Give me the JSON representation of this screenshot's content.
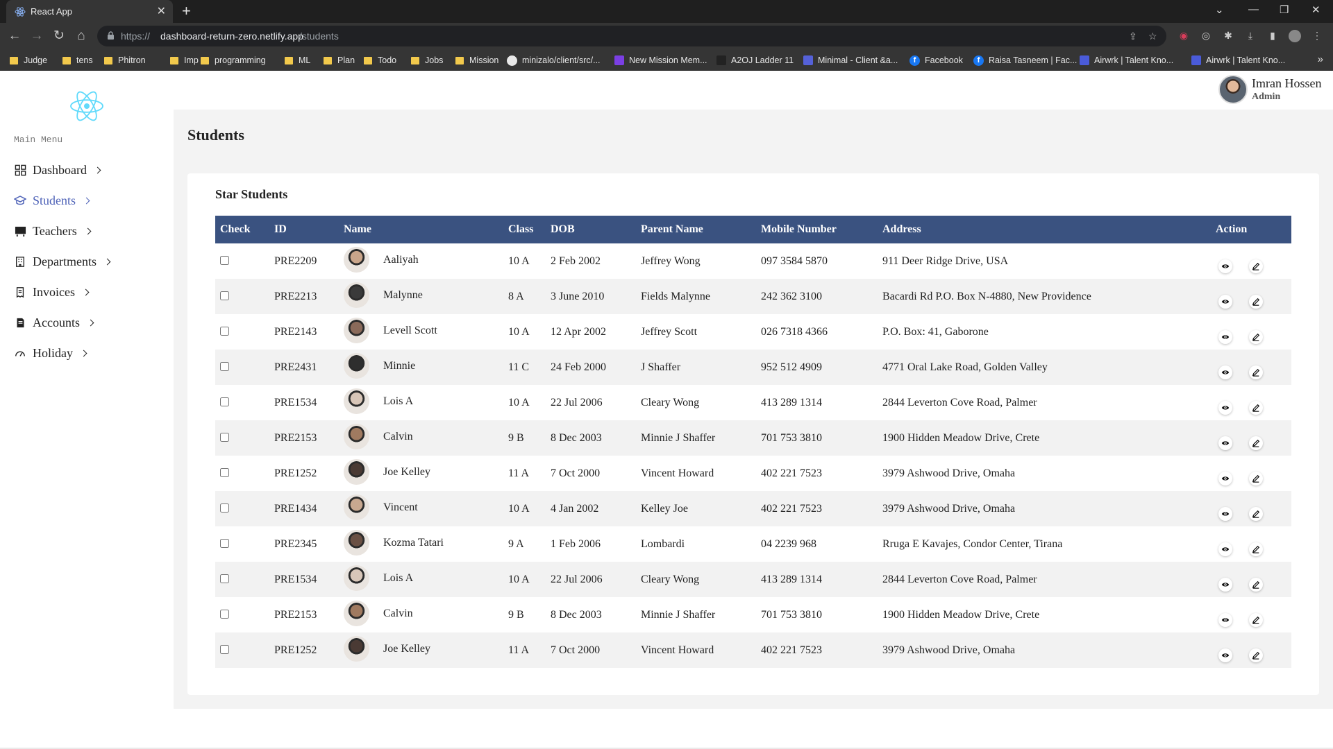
{
  "browser": {
    "tab_title": "React App",
    "tab_close": "✕",
    "new_tab": "+",
    "url_scheme": "https://",
    "url_host": "dashboard-return-zero.netlify.app",
    "url_path": "/students",
    "bookmarks": [
      "Judge",
      "tens",
      "Phitron",
      "Imp",
      "programming",
      "ML",
      "Plan",
      "Todo",
      "Jobs",
      "Mission",
      "minizalo/client/src/...",
      "New Mission Mem...",
      "A2OJ Ladder 11",
      "Minimal - Client &a...",
      "Facebook",
      "Raisa Tasneem | Fac...",
      "Airwrk | Talent Kno...",
      "Airwrk | Talent Kno..."
    ],
    "bookmarks_more": "»"
  },
  "sidebar": {
    "caption": "Main Menu",
    "items": [
      {
        "label": "Dashboard",
        "icon": "grid-icon"
      },
      {
        "label": "Students",
        "icon": "graduation-cap-icon",
        "active": true
      },
      {
        "label": "Teachers",
        "icon": "chalkboard-icon"
      },
      {
        "label": "Departments",
        "icon": "building-icon"
      },
      {
        "label": "Invoices",
        "icon": "receipt-icon"
      },
      {
        "label": "Accounts",
        "icon": "ledger-icon"
      },
      {
        "label": "Holiday",
        "icon": "gauge-icon"
      }
    ]
  },
  "user": {
    "name": "Imran Hossen",
    "role": "Admin"
  },
  "page": {
    "title": "Students",
    "card_title": "Star Students"
  },
  "table": {
    "headers": [
      "Check",
      "ID",
      "Name",
      "Class",
      "DOB",
      "Parent Name",
      "Mobile Number",
      "Address",
      "Action"
    ],
    "rows": [
      {
        "id": "PRE2209",
        "name": "Aaliyah",
        "class": "10 A",
        "dob": "2 Feb 2002",
        "parent": "Jeffrey Wong",
        "mobile": "097 3584 5870",
        "address": "911 Deer Ridge Drive, USA",
        "avatar_color": "#c9a58a"
      },
      {
        "id": "PRE2213",
        "name": "Malynne",
        "class": "8 A",
        "dob": "3 June 2010",
        "parent": "Fields Malynne",
        "mobile": "242 362 3100",
        "address": "Bacardi Rd P.O. Box N-4880, New Providence",
        "avatar_color": "#3a3a3a"
      },
      {
        "id": "PRE2143",
        "name": "Levell Scott",
        "class": "10 A",
        "dob": "12 Apr 2002",
        "parent": "Jeffrey Scott",
        "mobile": "026 7318 4366",
        "address": "P.O. Box: 41, Gaborone",
        "avatar_color": "#8a6a5a"
      },
      {
        "id": "PRE2431",
        "name": "Minnie",
        "class": "11 C",
        "dob": "24 Feb 2000",
        "parent": "J Shaffer",
        "mobile": "952 512 4909",
        "address": "4771 Oral Lake Road, Golden Valley",
        "avatar_color": "#2e2e2e"
      },
      {
        "id": "PRE1534",
        "name": "Lois A",
        "class": "10 A",
        "dob": "22 Jul 2006",
        "parent": "Cleary Wong",
        "mobile": "413 289 1314",
        "address": "2844 Leverton Cove Road, Palmer",
        "avatar_color": "#d8c6b8"
      },
      {
        "id": "PRE2153",
        "name": "Calvin",
        "class": "9 B",
        "dob": "8 Dec 2003",
        "parent": "Minnie J Shaffer",
        "mobile": "701 753 3810",
        "address": "1900 Hidden Meadow Drive, Crete",
        "avatar_color": "#a07a60"
      },
      {
        "id": "PRE1252",
        "name": "Joe Kelley",
        "class": "11 A",
        "dob": "7 Oct 2000",
        "parent": "Vincent Howard",
        "mobile": "402 221 7523",
        "address": "3979 Ashwood Drive, Omaha",
        "avatar_color": "#4a3a34"
      },
      {
        "id": "PRE1434",
        "name": "Vincent",
        "class": "10 A",
        "dob": "4 Jan 2002",
        "parent": "Kelley Joe",
        "mobile": "402 221 7523",
        "address": "3979 Ashwood Drive, Omaha",
        "avatar_color": "#c8a890"
      },
      {
        "id": "PRE2345",
        "name": "Kozma Tatari",
        "class": "9 A",
        "dob": "1 Feb 2006",
        "parent": "Lombardi",
        "mobile": "04 2239 968",
        "address": "Rruga E Kavajes, Condor Center, Tirana",
        "avatar_color": "#6a5044"
      },
      {
        "id": "PRE1534",
        "name": "Lois A",
        "class": "10 A",
        "dob": "22 Jul 2006",
        "parent": "Cleary Wong",
        "mobile": "413 289 1314",
        "address": "2844 Leverton Cove Road, Palmer",
        "avatar_color": "#d8c6b8"
      },
      {
        "id": "PRE2153",
        "name": "Calvin",
        "class": "9 B",
        "dob": "8 Dec 2003",
        "parent": "Minnie J Shaffer",
        "mobile": "701 753 3810",
        "address": "1900 Hidden Meadow Drive, Crete",
        "avatar_color": "#a07a60"
      },
      {
        "id": "PRE1252",
        "name": "Joe Kelley",
        "class": "11 A",
        "dob": "7 Oct 2000",
        "parent": "Vincent Howard",
        "mobile": "402 221 7523",
        "address": "3979 Ashwood Drive, Omaha",
        "avatar_color": "#4a3a34"
      }
    ]
  },
  "colors": {
    "table_header": "#3a5280",
    "active_menu": "#4f63b8",
    "content_bg": "#f3f3f3"
  }
}
